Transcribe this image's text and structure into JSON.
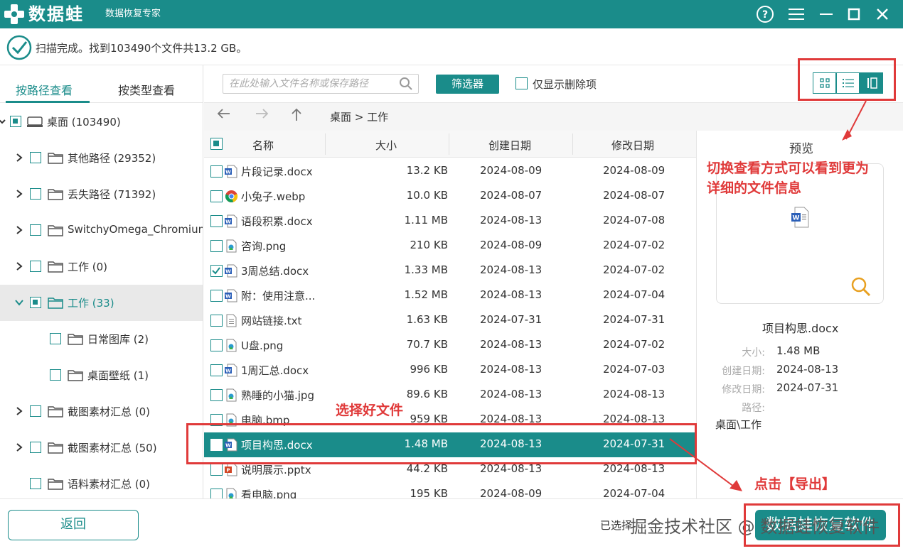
{
  "app": {
    "name": "数据蛙",
    "subtitle": "数据恢复专家"
  },
  "status": {
    "text": "扫描完成。找到103490个文件共13.2 GB。"
  },
  "left_tabs": [
    "按路径查看",
    "按类型查看"
  ],
  "tree": [
    {
      "label": "桌面 (103490)"
    },
    {
      "label": "其他路径 (29352)"
    },
    {
      "label": "丢失路径 (71392)"
    },
    {
      "label": "SwitchyOmega_Chromium"
    },
    {
      "label": "工作 (0)"
    },
    {
      "label": "工作 (33)"
    },
    {
      "label": "日常图库 (2)"
    },
    {
      "label": "桌面壁纸 (1)"
    },
    {
      "label": "截图素材汇总 (0)"
    },
    {
      "label": "截图素材汇总 (50)"
    },
    {
      "label": "语料素材汇总 (0)"
    }
  ],
  "toolbar": {
    "search_placeholder": "在此处输入文件名称或保存路径",
    "filter_label": "筛选器",
    "deleted_only_label": "仅显示删除项"
  },
  "breadcrumb": "桌面 > 工作",
  "columns": {
    "name": "名称",
    "size": "大小",
    "created": "创建日期",
    "modified": "修改日期"
  },
  "files": [
    {
      "name": "片段记录.docx",
      "size": "13.2 KB",
      "created": "2024-08-09",
      "modified": "2024-08-09",
      "type": "docx"
    },
    {
      "name": "小兔子.webp",
      "size": "10.0 KB",
      "created": "2024-08-07",
      "modified": "2024-08-07",
      "type": "webp"
    },
    {
      "name": "语段积累.docx",
      "size": "1.11 MB",
      "created": "2024-08-13",
      "modified": "2024-07-08",
      "type": "docx"
    },
    {
      "name": "咨询.png",
      "size": "210 KB",
      "created": "2024-08-09",
      "modified": "2024-07-02",
      "type": "image"
    },
    {
      "name": "3周总结.docx",
      "size": "1.33 MB",
      "created": "2024-08-13",
      "modified": "2024-07-02",
      "type": "docx",
      "checked": true
    },
    {
      "name": "附：使用注意...",
      "size": "1.52 MB",
      "created": "2024-08-13",
      "modified": "2024-07-04",
      "type": "docx"
    },
    {
      "name": "网站链接.txt",
      "size": "1.63 KB",
      "created": "2024-07-31",
      "modified": "2024-07-31",
      "type": "txt"
    },
    {
      "name": "U盘.png",
      "size": "70.7 KB",
      "created": "2024-08-13",
      "modified": "2024-07-02",
      "type": "image"
    },
    {
      "name": "1周汇总.docx",
      "size": "996 KB",
      "created": "2024-08-13",
      "modified": "2024-07-03",
      "type": "docx"
    },
    {
      "name": "熟睡的小猫.jpg",
      "size": "89.6 KB",
      "created": "2024-08-13",
      "modified": "2024-08-13",
      "type": "image"
    },
    {
      "name": "电脑.bmp",
      "size": "959 KB",
      "created": "2024-08-13",
      "modified": "2024-08-13",
      "type": "image"
    },
    {
      "name": "项目构思.docx",
      "size": "1.48 MB",
      "created": "2024-08-13",
      "modified": "2024-07-31",
      "type": "docx",
      "highlighted": true
    },
    {
      "name": "说明展示.pptx",
      "size": "44.2 KB",
      "created": "2024-08-13",
      "modified": "2024-08-13",
      "type": "pptx"
    },
    {
      "name": "看电脑.png",
      "size": "195 KB",
      "created": "2024-08-09",
      "modified": "2024-07-04",
      "type": "image"
    }
  ],
  "preview": {
    "title": "预览",
    "file_name": "项目构思.docx",
    "size_label": "大小:",
    "size": "1.48 MB",
    "created_label": "创建日期:",
    "created": "2024-08-13",
    "modified_label": "修改日期:",
    "modified": "2024-07-31",
    "path_label": "路径:",
    "path": "桌面\\工作"
  },
  "bottom": {
    "back_label": "返回",
    "selected_text": "已选择",
    "export_label": "数据蛙恢复软件",
    "watermark": "掘金技术社区 @ 数据蛙恢复软件"
  },
  "annotations": {
    "view_switch": "切换查看方式可以看到更为详细的文件信息",
    "select_file": "选择好文件",
    "click_export": "点击【导出】"
  },
  "colors": {
    "accent": "#1a8c8a",
    "annotation": "#e03a3a"
  }
}
